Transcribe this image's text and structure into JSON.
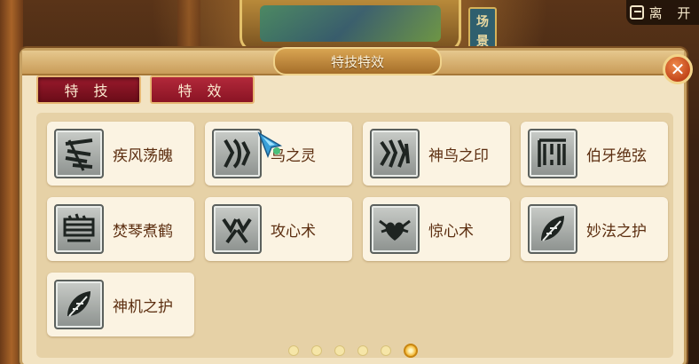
{
  "scene": {
    "sign_text": "场 景",
    "leave_label": "离 开"
  },
  "panel": {
    "title": "特技特效",
    "close_icon": "close-x-icon"
  },
  "tabs": [
    {
      "label": "特 技",
      "active": true
    },
    {
      "label": "特 效",
      "active": false
    }
  ],
  "skills": [
    {
      "name": "疾风荡魄",
      "icon": "wind-slash-icon"
    },
    {
      "name": "鸟之灵",
      "icon": "bird-spirit-icon"
    },
    {
      "name": "神鸟之印",
      "icon": "divine-bird-seal-icon"
    },
    {
      "name": "伯牙绝弦",
      "icon": "broken-strings-icon"
    },
    {
      "name": "焚琴煮鹤",
      "icon": "zither-icon"
    },
    {
      "name": "攻心术",
      "icon": "twin-hearts-icon"
    },
    {
      "name": "惊心术",
      "icon": "winged-heart-icon"
    },
    {
      "name": "妙法之护",
      "icon": "feather-shield-icon"
    },
    {
      "name": "神机之护",
      "icon": "feather-shield-icon"
    }
  ],
  "pager": {
    "total_pages": 6,
    "current_page": 6
  },
  "colors": {
    "tab_red": "#8a1424",
    "skill_text": "#5c2e10",
    "panel_bg": "#f2e3c2"
  }
}
